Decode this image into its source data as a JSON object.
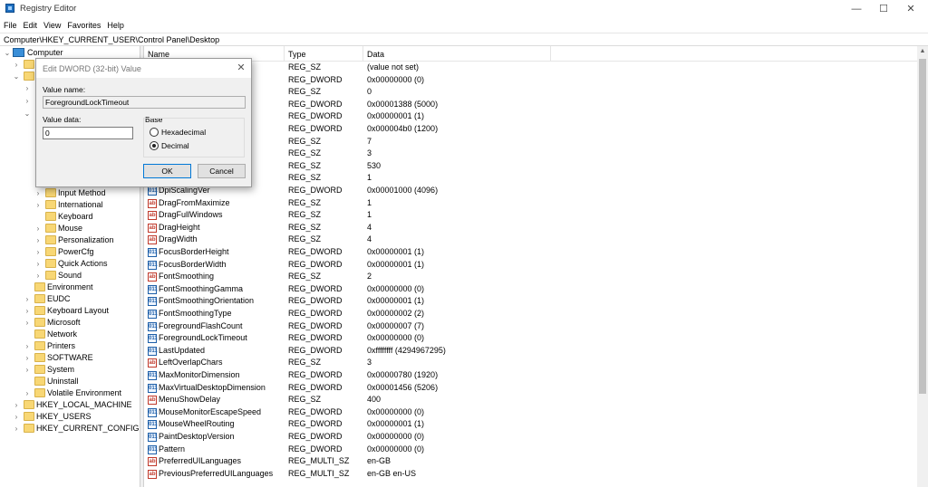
{
  "window": {
    "title": "Registry Editor",
    "minimize": "—",
    "maximize": "☐",
    "close": "✕"
  },
  "menu": [
    "File",
    "Edit",
    "View",
    "Favorites",
    "Help"
  ],
  "address": "Computer\\HKEY_CURRENT_USER\\Control Panel\\Desktop",
  "tree": {
    "root": "Computer",
    "visible_items": [
      {
        "label": "Input Method"
      },
      {
        "label": "International"
      },
      {
        "label": "Keyboard"
      },
      {
        "label": "Mouse"
      },
      {
        "label": "Personalization"
      },
      {
        "label": "PowerCfg"
      },
      {
        "label": "Quick Actions"
      },
      {
        "label": "Sound"
      },
      {
        "label": "Environment"
      },
      {
        "label": "EUDC"
      },
      {
        "label": "Keyboard Layout"
      },
      {
        "label": "Microsoft"
      },
      {
        "label": "Network"
      },
      {
        "label": "Printers"
      },
      {
        "label": "SOFTWARE"
      },
      {
        "label": "System"
      },
      {
        "label": "Uninstall"
      },
      {
        "label": "Volatile Environment"
      },
      {
        "label": "HKEY_LOCAL_MACHINE"
      },
      {
        "label": "HKEY_USERS"
      },
      {
        "label": "HKEY_CURRENT_CONFIG"
      }
    ]
  },
  "list": {
    "headers": {
      "name": "Name",
      "type": "Type",
      "data": "Data"
    },
    "rows": [
      {
        "name": "",
        "type": "REG_SZ",
        "data": "(value not set)",
        "icon": "ab"
      },
      {
        "name": "",
        "type": "REG_DWORD",
        "data": "0x00000000 (0)",
        "icon": "bin"
      },
      {
        "name": "",
        "type": "REG_SZ",
        "data": "0",
        "icon": "ab"
      },
      {
        "name": "",
        "type": "REG_DWORD",
        "data": "0x00001388 (5000)",
        "icon": "bin"
      },
      {
        "name": "",
        "type": "REG_DWORD",
        "data": "0x00000001 (1)",
        "icon": "bin"
      },
      {
        "name": "",
        "type": "REG_DWORD",
        "data": "0x000004b0 (1200)",
        "icon": "bin"
      },
      {
        "name": "",
        "type": "REG_SZ",
        "data": "7",
        "icon": "ab"
      },
      {
        "name": "",
        "type": "REG_SZ",
        "data": "3",
        "icon": "ab"
      },
      {
        "name": "",
        "type": "REG_SZ",
        "data": "530",
        "icon": "ab"
      },
      {
        "name": "",
        "type": "REG_SZ",
        "data": "1",
        "icon": "ab"
      },
      {
        "name": "DpiScalingVer",
        "type": "REG_DWORD",
        "data": "0x00001000 (4096)",
        "icon": "bin"
      },
      {
        "name": "DragFromMaximize",
        "type": "REG_SZ",
        "data": "1",
        "icon": "ab"
      },
      {
        "name": "DragFullWindows",
        "type": "REG_SZ",
        "data": "1",
        "icon": "ab"
      },
      {
        "name": "DragHeight",
        "type": "REG_SZ",
        "data": "4",
        "icon": "ab"
      },
      {
        "name": "DragWidth",
        "type": "REG_SZ",
        "data": "4",
        "icon": "ab"
      },
      {
        "name": "FocusBorderHeight",
        "type": "REG_DWORD",
        "data": "0x00000001 (1)",
        "icon": "bin"
      },
      {
        "name": "FocusBorderWidth",
        "type": "REG_DWORD",
        "data": "0x00000001 (1)",
        "icon": "bin"
      },
      {
        "name": "FontSmoothing",
        "type": "REG_SZ",
        "data": "2",
        "icon": "ab"
      },
      {
        "name": "FontSmoothingGamma",
        "type": "REG_DWORD",
        "data": "0x00000000 (0)",
        "icon": "bin"
      },
      {
        "name": "FontSmoothingOrientation",
        "type": "REG_DWORD",
        "data": "0x00000001 (1)",
        "icon": "bin"
      },
      {
        "name": "FontSmoothingType",
        "type": "REG_DWORD",
        "data": "0x00000002 (2)",
        "icon": "bin"
      },
      {
        "name": "ForegroundFlashCount",
        "type": "REG_DWORD",
        "data": "0x00000007 (7)",
        "icon": "bin"
      },
      {
        "name": "ForegroundLockTimeout",
        "type": "REG_DWORD",
        "data": "0x00000000 (0)",
        "icon": "bin"
      },
      {
        "name": "LastUpdated",
        "type": "REG_DWORD",
        "data": "0xffffffff (4294967295)",
        "icon": "bin"
      },
      {
        "name": "LeftOverlapChars",
        "type": "REG_SZ",
        "data": "3",
        "icon": "ab"
      },
      {
        "name": "MaxMonitorDimension",
        "type": "REG_DWORD",
        "data": "0x00000780 (1920)",
        "icon": "bin"
      },
      {
        "name": "MaxVirtualDesktopDimension",
        "type": "REG_DWORD",
        "data": "0x00001456 (5206)",
        "icon": "bin"
      },
      {
        "name": "MenuShowDelay",
        "type": "REG_SZ",
        "data": "400",
        "icon": "ab"
      },
      {
        "name": "MouseMonitorEscapeSpeed",
        "type": "REG_DWORD",
        "data": "0x00000000 (0)",
        "icon": "bin"
      },
      {
        "name": "MouseWheelRouting",
        "type": "REG_DWORD",
        "data": "0x00000001 (1)",
        "icon": "bin"
      },
      {
        "name": "PaintDesktopVersion",
        "type": "REG_DWORD",
        "data": "0x00000000 (0)",
        "icon": "bin"
      },
      {
        "name": "Pattern",
        "type": "REG_DWORD",
        "data": "0x00000000 (0)",
        "icon": "bin"
      },
      {
        "name": "PreferredUILanguages",
        "type": "REG_MULTI_SZ",
        "data": "en-GB",
        "icon": "ab"
      },
      {
        "name": "PreviousPreferredUILanguages",
        "type": "REG_MULTI_SZ",
        "data": "en-GB en-US",
        "icon": "ab"
      }
    ]
  },
  "dialog": {
    "title": "Edit DWORD (32-bit) Value",
    "close": "✕",
    "value_name_label": "Value name:",
    "value_name": "ForegroundLockTimeout",
    "value_data_label": "Value data:",
    "value_data": "0",
    "base_label": "Base",
    "hex_label": "Hexadecimal",
    "dec_label": "Decimal",
    "selected_base": "Decimal",
    "ok_label": "OK",
    "cancel_label": "Cancel"
  },
  "icons": {
    "string_value": "ab",
    "binary_value": "011"
  }
}
